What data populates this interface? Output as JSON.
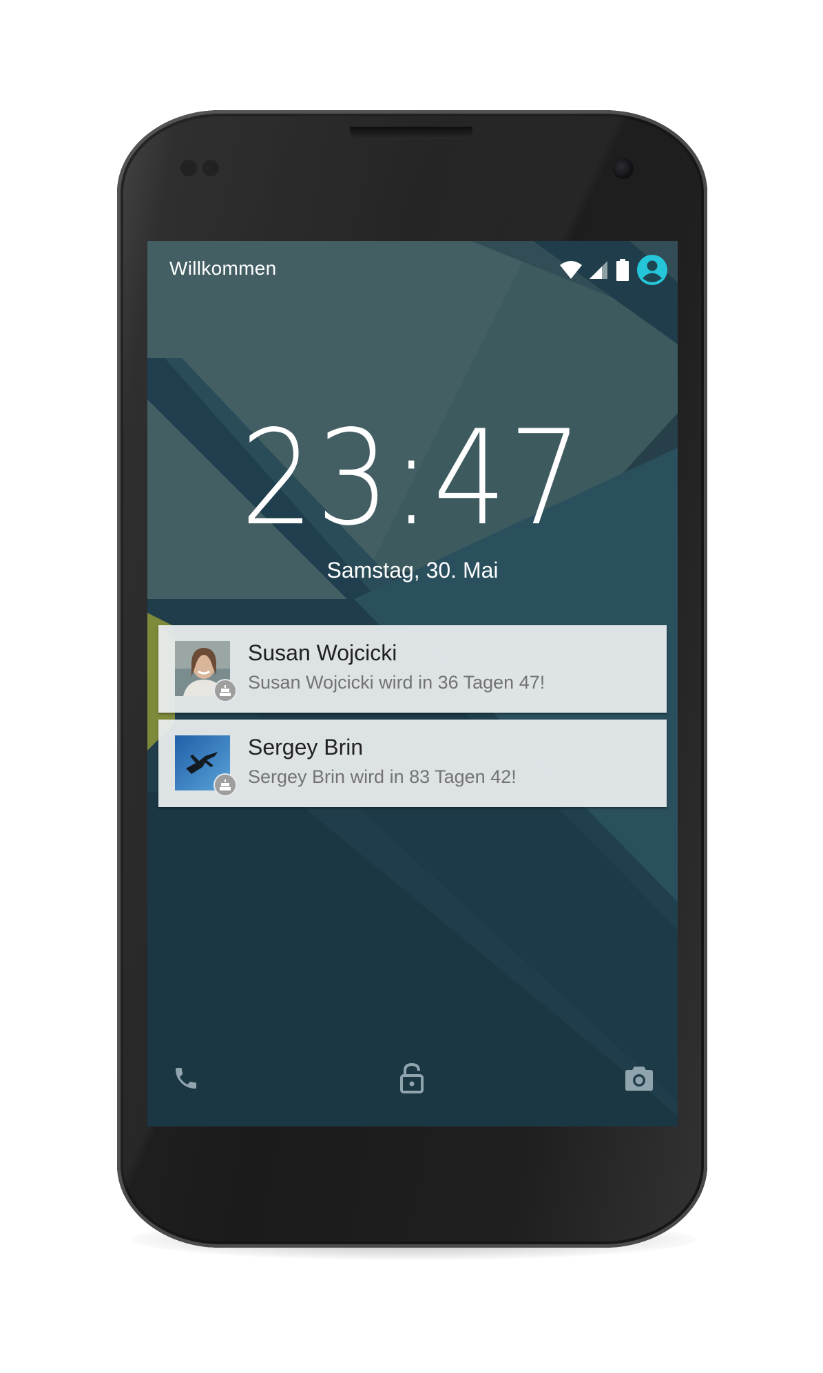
{
  "status_bar": {
    "carrier_label": "Willkommen",
    "icons": [
      "wifi-icon",
      "cell-signal-icon",
      "battery-icon",
      "user-avatar-icon"
    ],
    "accent_color": "#26c6da"
  },
  "lockscreen": {
    "time": "23:47",
    "date": "Samstag, 30. Mai"
  },
  "notifications": [
    {
      "title": "Susan Wojcicki",
      "text": "Susan Wojcicki wird in 36 Tagen 47!",
      "badge_icon": "cake-icon"
    },
    {
      "title": "Sergey Brin",
      "text": "Sergey Brin wird in 83 Tagen 42!",
      "badge_icon": "cake-icon"
    }
  ],
  "bottom_actions": {
    "left": "phone-icon",
    "center": "unlock-icon",
    "right": "camera-icon"
  }
}
